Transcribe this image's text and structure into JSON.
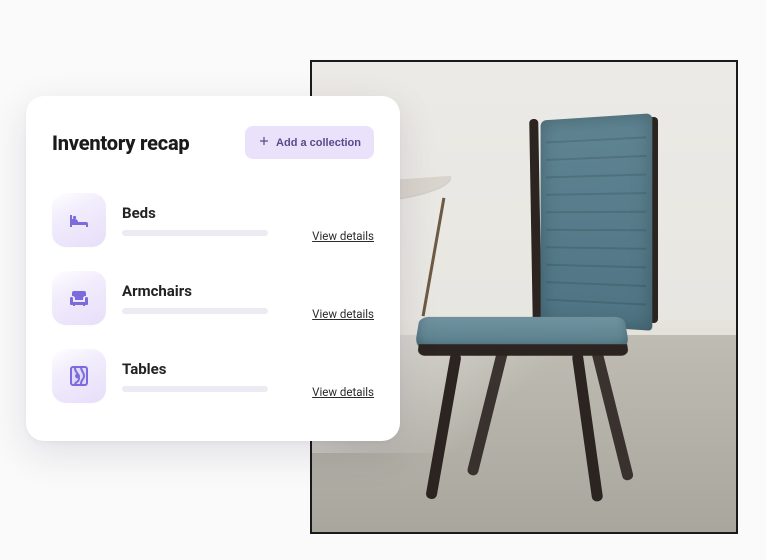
{
  "card": {
    "title": "Inventory recap",
    "add_button": "Add a collection"
  },
  "items": [
    {
      "name": "Beds",
      "action": "View details",
      "icon": "bed-icon"
    },
    {
      "name": "Armchairs",
      "action": "View details",
      "icon": "armchair-icon"
    },
    {
      "name": "Tables",
      "action": "View details",
      "icon": "wood-icon"
    }
  ],
  "colors": {
    "accent": "#7c6bdc",
    "pill_bg": "#eae1fb",
    "icon_fill": "#7c6bdc"
  }
}
